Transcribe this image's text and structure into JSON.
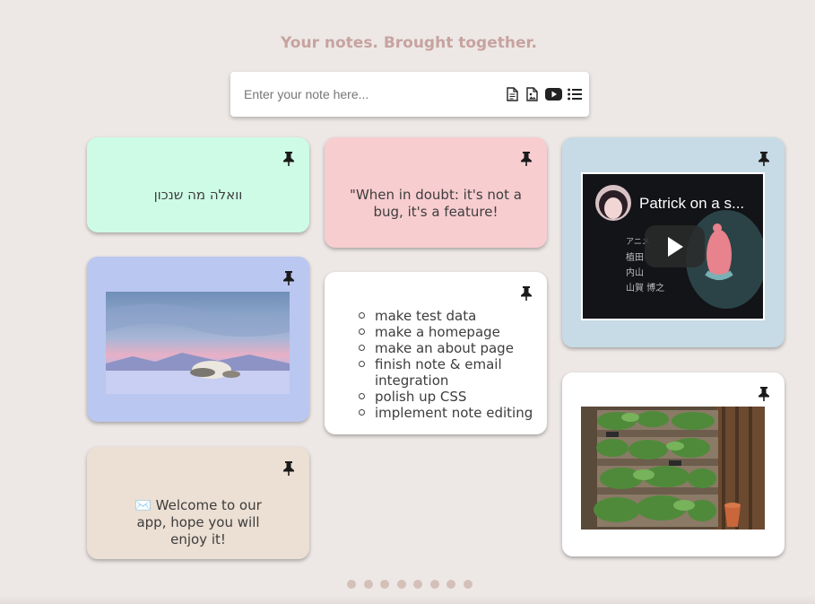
{
  "header": {
    "tagline": "Your notes. Brought together."
  },
  "composer": {
    "placeholder": "Enter your note here...",
    "tools": [
      "text-note-icon",
      "image-note-icon",
      "video-note-icon",
      "list-note-icon"
    ]
  },
  "notes": [
    {
      "kind": "text",
      "color": "#cdfbe6",
      "text": "וואלה מה שנכון"
    },
    {
      "kind": "text",
      "color": "#f8cdd0",
      "text": "\"When in doubt: it's not a bug, it's a feature!"
    },
    {
      "kind": "video",
      "color": "#c6dbe5",
      "video_title": "Patrick on a s..."
    },
    {
      "kind": "image",
      "color": "#bac7f0",
      "image": "sleeping-bison-landscape"
    },
    {
      "kind": "list",
      "color": "#ffffff",
      "items": [
        "make test data",
        "make a homepage",
        "make an about page",
        "finish note & email integration",
        "polish up CSS",
        "implement note editing"
      ]
    },
    {
      "kind": "image",
      "color": "#ffffff",
      "image": "pallet-herb-garden"
    },
    {
      "kind": "text",
      "color": "#ecdfd3",
      "text": "✉️ Welcome to our app, hope you will enjoy it!"
    }
  ],
  "pagination": {
    "count": 8
  }
}
